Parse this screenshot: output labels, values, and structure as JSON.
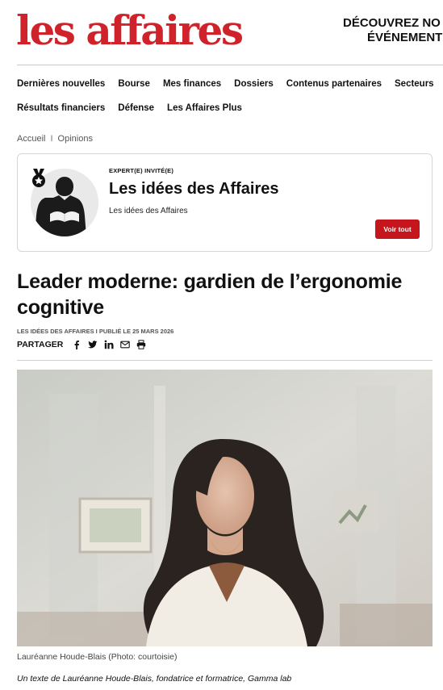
{
  "brand": {
    "logo_text": "les affaires",
    "color": "#d0222a"
  },
  "promo": {
    "line1": "DÉCOUVREZ NO",
    "line2": "ÉVÉNEMENT"
  },
  "nav": {
    "row1": [
      "Dernières nouvelles",
      "Bourse",
      "Mes finances",
      "Dossiers",
      "Contenus partenaires",
      "Secteurs"
    ],
    "row2": [
      "Résultats financiers",
      "Défense",
      "Les Affaires Plus"
    ]
  },
  "breadcrumb": {
    "items": [
      "Accueil",
      "Opinions"
    ],
    "separator": "I"
  },
  "author_card": {
    "kicker": "EXPERT(E) INVITÉ(E)",
    "name": "Les idées des Affaires",
    "subtitle": "Les idées des Affaires",
    "button_label": "Voir tout",
    "button_color": "#c4161c"
  },
  "article": {
    "title": "Leader moderne: gardien de l’ergonomie cognitive",
    "meta": "LES IDÉES DES AFFAIRES I PUBLIÉ LE 25 MARS 2026",
    "share_label": "PARTAGER",
    "share_icons": [
      "facebook-icon",
      "twitter-icon",
      "linkedin-icon",
      "email-icon",
      "print-icon"
    ],
    "photo_caption": "Lauréanne Houde-Blais (Photo: courtoisie)",
    "byline": "Un texte de Lauréanne Houde-Blais, fondatrice et formatrice, Gamma lab"
  }
}
